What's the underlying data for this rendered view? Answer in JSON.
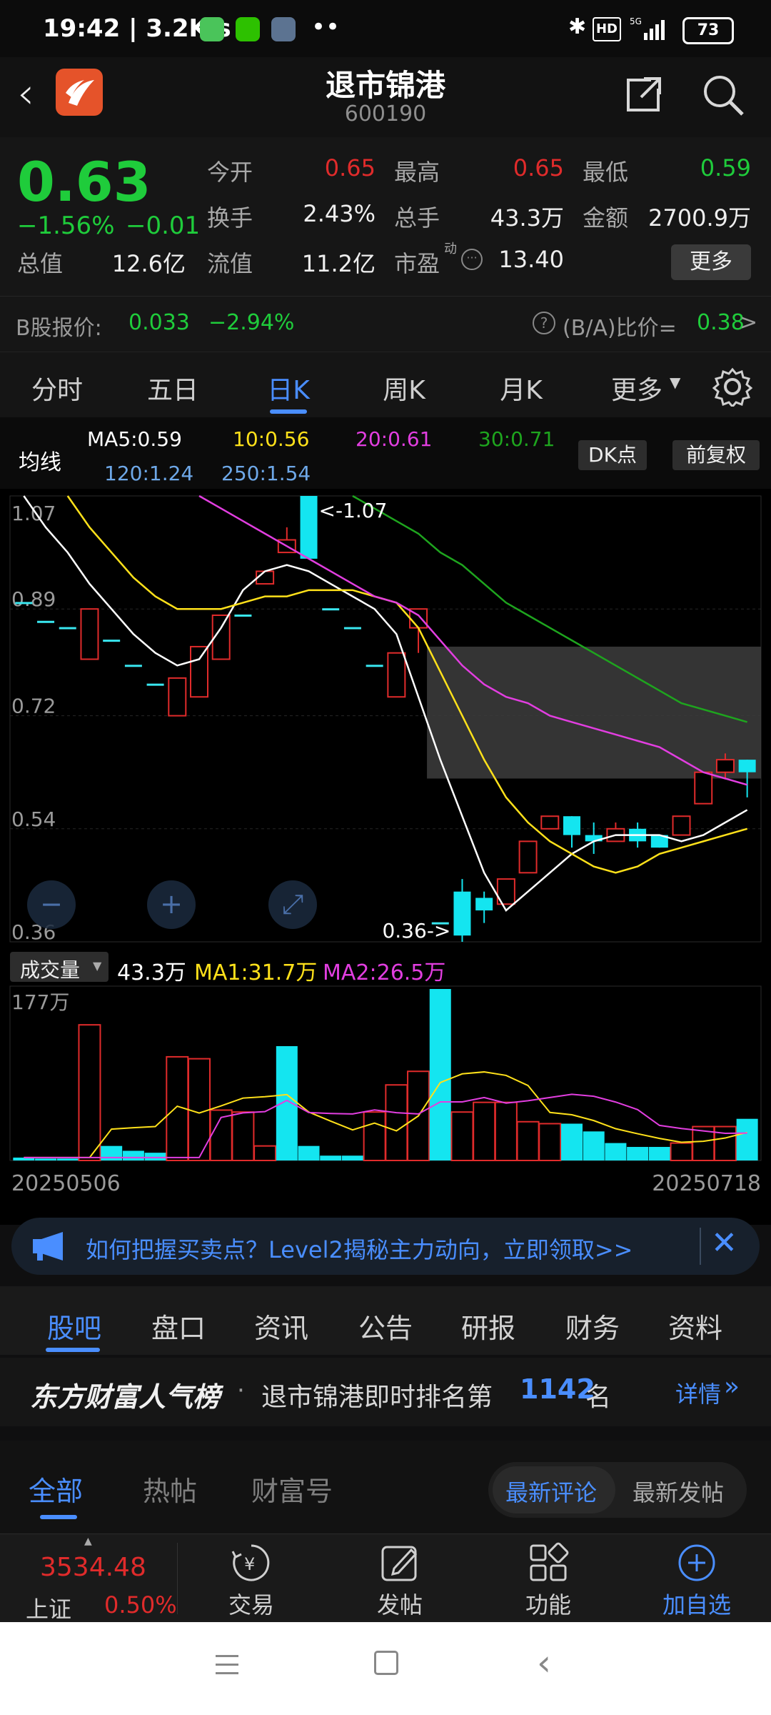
{
  "status": {
    "time_speed": "19:42 | 3.2K/s",
    "battery": "73"
  },
  "header": {
    "title": "退市锦港",
    "code": "600190"
  },
  "quote": {
    "price": "0.63",
    "change_pct": "−1.56%",
    "change_abs": "−0.01",
    "open_label": "今开",
    "open_value": "0.65",
    "high_label": "最高",
    "high_value": "0.65",
    "low_label": "最低",
    "low_value": "0.59",
    "turnover_label": "换手",
    "turnover_value": "2.43%",
    "volume_label": "总手",
    "volume_value": "43.3万",
    "amount_label": "金额",
    "amount_value": "2700.9万",
    "mcap_label": "总值",
    "mcap_value": "12.6亿",
    "float_label": "流值",
    "float_value": "11.2亿",
    "pe_label": "市盈",
    "pe_sup": "动",
    "pe_value": "13.40",
    "more_label": "更多"
  },
  "bshare": {
    "label": "B股报价:",
    "price": "0.033",
    "change": "−2.94%",
    "ratio_label": "(B/A)比价=",
    "ratio_value": "0.38",
    "arrow": ">"
  },
  "tabs": [
    "分时",
    "五日",
    "日K",
    "周K",
    "月K",
    "更多"
  ],
  "ma_legend": {
    "title": "均线",
    "ma5": "MA5:0.59",
    "ma10": "10:0.56",
    "ma20": "20:0.61",
    "ma30": "30:0.71",
    "ma120": "120:1.24",
    "ma250": "250:1.54",
    "dk_label": "DK点",
    "adjust_label": "前复权",
    "colors": {
      "ma5": "#ffffff",
      "ma10": "#ffe11a",
      "ma20": "#e23ee0",
      "ma30": "#1ea51e",
      "ma120": "#6ea8e8",
      "ma250": "#6ea8e8"
    }
  },
  "chart_data": [
    {
      "type": "candlestick",
      "y_ticks": [
        "1.07",
        "0.89",
        "0.72",
        "0.54",
        "0.36"
      ],
      "ylim": [
        0.36,
        1.07
      ],
      "high_annotation": "<-1.07",
      "low_annotation": "0.36->",
      "candles": [
        {
          "o": 0.9,
          "c": 0.9,
          "h": 0.9,
          "l": 0.9
        },
        {
          "o": 0.87,
          "c": 0.87,
          "h": 0.87,
          "l": 0.87
        },
        {
          "o": 0.86,
          "c": 0.86,
          "h": 0.86,
          "l": 0.86
        },
        {
          "o": 0.81,
          "c": 0.89,
          "h": 0.89,
          "l": 0.81
        },
        {
          "o": 0.84,
          "c": 0.84,
          "h": 0.84,
          "l": 0.84
        },
        {
          "o": 0.8,
          "c": 0.8,
          "h": 0.8,
          "l": 0.8
        },
        {
          "o": 0.77,
          "c": 0.77,
          "h": 0.77,
          "l": 0.77
        },
        {
          "o": 0.72,
          "c": 0.78,
          "h": 0.78,
          "l": 0.72
        },
        {
          "o": 0.75,
          "c": 0.83,
          "h": 0.83,
          "l": 0.75
        },
        {
          "o": 0.81,
          "c": 0.88,
          "h": 0.88,
          "l": 0.81
        },
        {
          "o": 0.88,
          "c": 0.88,
          "h": 0.88,
          "l": 0.88
        },
        {
          "o": 0.93,
          "c": 0.95,
          "h": 0.95,
          "l": 0.93
        },
        {
          "o": 0.98,
          "c": 1.0,
          "h": 1.02,
          "l": 0.98
        },
        {
          "o": 1.07,
          "c": 0.97,
          "h": 1.07,
          "l": 0.97
        },
        {
          "o": 0.89,
          "c": 0.89,
          "h": 0.89,
          "l": 0.89
        },
        {
          "o": 0.86,
          "c": 0.86,
          "h": 0.86,
          "l": 0.86
        },
        {
          "o": 0.8,
          "c": 0.8,
          "h": 0.8,
          "l": 0.8
        },
        {
          "o": 0.75,
          "c": 0.82,
          "h": 0.82,
          "l": 0.75
        },
        {
          "o": 0.86,
          "c": 0.89,
          "h": 0.89,
          "l": 0.82
        },
        {
          "o": 0.39,
          "c": 0.39,
          "h": 0.39,
          "l": 0.39
        },
        {
          "o": 0.44,
          "c": 0.37,
          "h": 0.46,
          "l": 0.36
        },
        {
          "o": 0.43,
          "c": 0.41,
          "h": 0.44,
          "l": 0.39
        },
        {
          "o": 0.42,
          "c": 0.46,
          "h": 0.46,
          "l": 0.42
        },
        {
          "o": 0.47,
          "c": 0.52,
          "h": 0.52,
          "l": 0.47
        },
        {
          "o": 0.54,
          "c": 0.56,
          "h": 0.56,
          "l": 0.54
        },
        {
          "o": 0.56,
          "c": 0.53,
          "h": 0.56,
          "l": 0.51
        },
        {
          "o": 0.53,
          "c": 0.52,
          "h": 0.55,
          "l": 0.5
        },
        {
          "o": 0.52,
          "c": 0.54,
          "h": 0.55,
          "l": 0.52
        },
        {
          "o": 0.54,
          "c": 0.52,
          "h": 0.55,
          "l": 0.51
        },
        {
          "o": 0.53,
          "c": 0.51,
          "h": 0.53,
          "l": 0.51
        },
        {
          "o": 0.53,
          "c": 0.56,
          "h": 0.56,
          "l": 0.53
        },
        {
          "o": 0.58,
          "c": 0.63,
          "h": 0.63,
          "l": 0.58
        },
        {
          "o": 0.63,
          "c": 0.65,
          "h": 0.66,
          "l": 0.62
        },
        {
          "o": 0.65,
          "c": 0.63,
          "h": 0.65,
          "l": 0.59
        }
      ],
      "series": [
        {
          "name": "MA5",
          "color": "#ffffff",
          "values": [
            1.07,
            1.02,
            0.98,
            0.93,
            0.89,
            0.85,
            0.82,
            0.8,
            0.81,
            0.86,
            0.92,
            0.95,
            0.96,
            0.95,
            0.93,
            0.91,
            0.89,
            0.85,
            0.75,
            0.65,
            0.56,
            0.47,
            0.41,
            0.44,
            0.47,
            0.5,
            0.52,
            0.53,
            0.53,
            0.53,
            0.52,
            0.53,
            0.55,
            0.57
          ]
        },
        {
          "name": "10",
          "color": "#ffe11a",
          "values": [
            null,
            null,
            1.07,
            1.02,
            0.98,
            0.94,
            0.91,
            0.89,
            0.89,
            0.89,
            0.9,
            0.91,
            0.91,
            0.92,
            0.92,
            0.92,
            0.91,
            0.9,
            0.86,
            0.79,
            0.72,
            0.65,
            0.59,
            0.55,
            0.52,
            0.5,
            0.48,
            0.47,
            0.48,
            0.5,
            0.51,
            0.52,
            0.53,
            0.54
          ]
        },
        {
          "name": "20",
          "color": "#e23ee0",
          "values": [
            null,
            null,
            null,
            null,
            null,
            null,
            null,
            null,
            1.07,
            1.05,
            1.03,
            1.01,
            0.99,
            0.97,
            0.95,
            0.93,
            0.91,
            0.9,
            0.88,
            0.84,
            0.8,
            0.77,
            0.75,
            0.74,
            0.72,
            0.71,
            0.7,
            0.69,
            0.68,
            0.67,
            0.65,
            0.63,
            0.62,
            0.61
          ]
        },
        {
          "name": "30",
          "color": "#1ea51e",
          "values": [
            null,
            null,
            null,
            null,
            null,
            null,
            null,
            null,
            null,
            null,
            null,
            null,
            null,
            null,
            null,
            1.07,
            1.05,
            1.03,
            1.01,
            0.98,
            0.96,
            0.93,
            0.9,
            0.88,
            0.86,
            0.84,
            0.82,
            0.8,
            0.78,
            0.76,
            0.74,
            0.73,
            0.72,
            0.71
          ]
        }
      ],
      "x_start": "20250506",
      "x_end": "20250718"
    },
    {
      "type": "bar",
      "label": "成交量",
      "current": "43.3万",
      "ma1": "MA1:31.7万",
      "ma2": "MA2:26.5万",
      "y_top": "177万",
      "values": [
        3,
        2,
        2,
        140,
        15,
        10,
        8,
        107,
        105,
        52,
        50,
        15,
        118,
        15,
        5,
        5,
        50,
        78,
        92,
        177,
        50,
        60,
        60,
        40,
        38,
        38,
        30,
        18,
        14,
        14,
        18,
        35,
        35,
        43
      ],
      "up": [
        false,
        false,
        false,
        true,
        false,
        false,
        false,
        true,
        true,
        true,
        true,
        true,
        false,
        false,
        false,
        false,
        true,
        true,
        true,
        false,
        true,
        true,
        true,
        true,
        true,
        false,
        false,
        false,
        false,
        false,
        true,
        true,
        true,
        false
      ]
    }
  ],
  "ad": {
    "text": "如何把握买卖点？Level2揭秘主力动向，立即领取>>"
  },
  "sub_tabs": [
    "股吧",
    "盘口",
    "资讯",
    "公告",
    "研报",
    "财务",
    "资料"
  ],
  "popular": {
    "brand": "东方财富人气榜",
    "sep": "·",
    "prefix": "退市锦港即时排名第",
    "rank": "1142",
    "suffix": "名",
    "details": "详情"
  },
  "feed_tabs": [
    "全部",
    "热帖",
    "财富号"
  ],
  "feed_sort": [
    "最新评论",
    "最新发帖"
  ],
  "bottom": {
    "index_value": "3534.48",
    "index_name": "上证",
    "index_change": "0.50%",
    "trade": "交易",
    "post": "发帖",
    "functions": "功能",
    "add_watch": "加自选"
  }
}
